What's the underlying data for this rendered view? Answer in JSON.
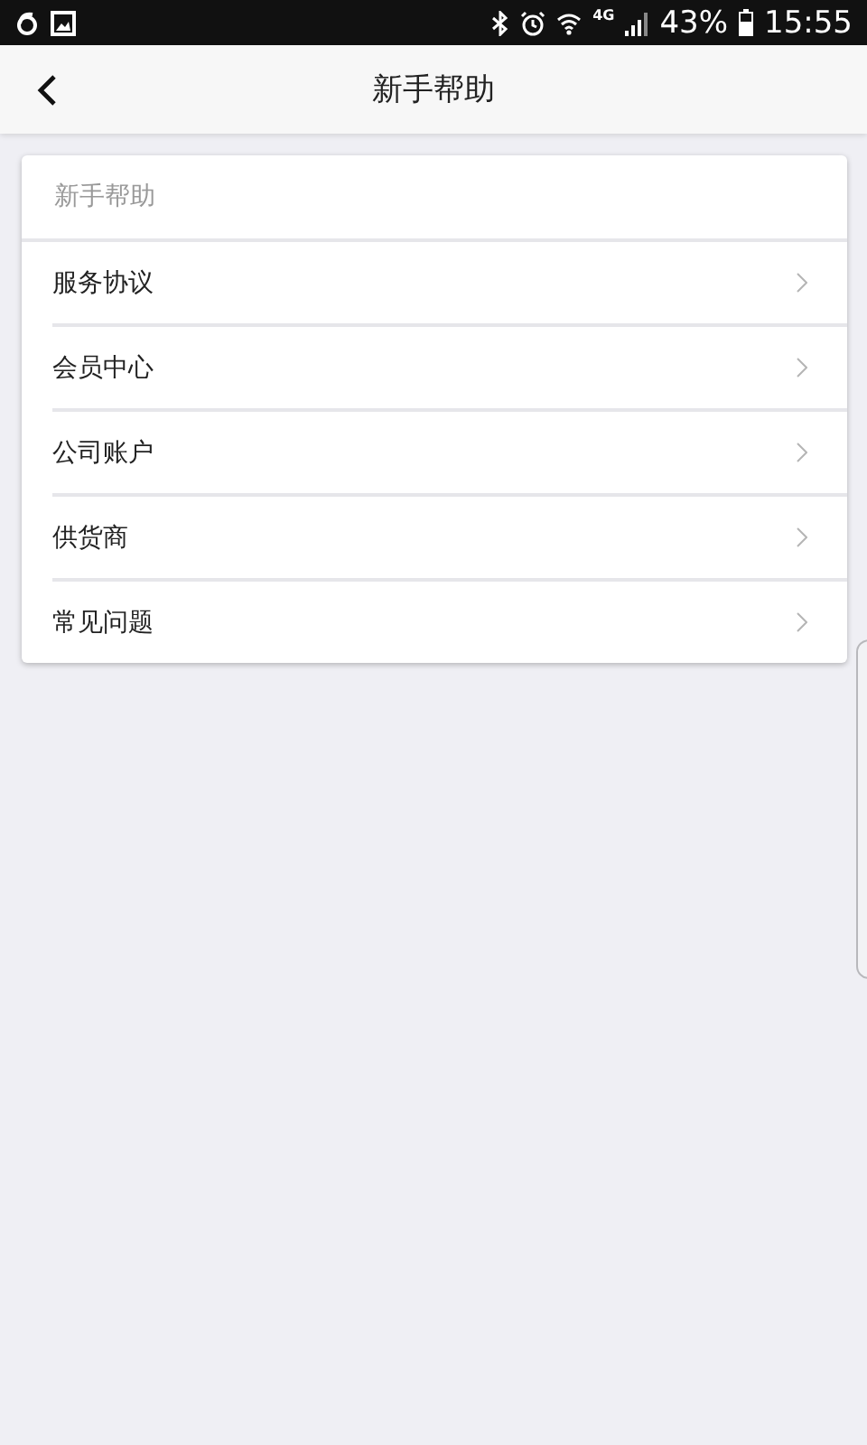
{
  "status_bar": {
    "battery_percent": "43%",
    "time": "15:55",
    "network": "4G"
  },
  "nav_bar": {
    "title": "新手帮助"
  },
  "section": {
    "header": "新手帮助",
    "items": [
      {
        "label": "服务协议"
      },
      {
        "label": "会员中心"
      },
      {
        "label": "公司账户"
      },
      {
        "label": "供货商"
      },
      {
        "label": "常见问题"
      }
    ]
  }
}
